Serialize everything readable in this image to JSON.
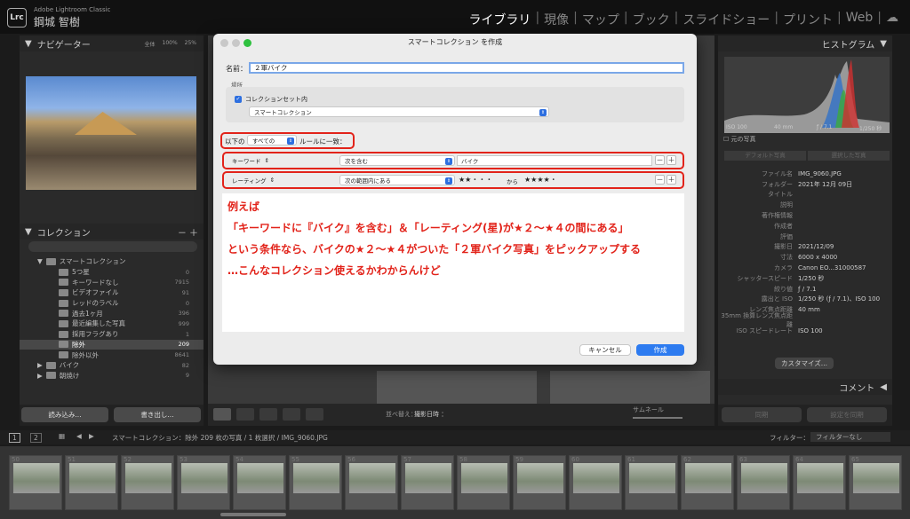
{
  "app": {
    "logo": "Lrc",
    "name": "Adobe Lightroom Classic",
    "user": "鋼城 智樹"
  },
  "modules": [
    "ライブラリ",
    "現像",
    "マップ",
    "ブック",
    "スライドショー",
    "プリント",
    "Web"
  ],
  "left": {
    "navigator": {
      "title": "ナビゲーター",
      "zoom": [
        "全体",
        "100%",
        "25%"
      ]
    },
    "collections": {
      "title": "コレクション",
      "smart_set": "スマートコレクション",
      "items": [
        {
          "label": "5つ星",
          "count": "0"
        },
        {
          "label": "キーワードなし",
          "count": "7915"
        },
        {
          "label": "ビデオファイル",
          "count": "91"
        },
        {
          "label": "レッドのラベル",
          "count": "0"
        },
        {
          "label": "過去1ヶ月",
          "count": "396"
        },
        {
          "label": "最近編集した写真",
          "count": "999"
        },
        {
          "label": "採用フラグあり",
          "count": "1"
        },
        {
          "label": "除外",
          "count": "209"
        },
        {
          "label": "除外以外",
          "count": "8641"
        }
      ],
      "folders": [
        {
          "label": "バイク",
          "count": "82"
        },
        {
          "label": "朝焼け",
          "count": "9"
        }
      ]
    },
    "import_btn": "読み込み...",
    "export_btn": "書き出し..."
  },
  "toolbar": {
    "sort_label": "並べ替え：",
    "sort_value": "撮影日時 ：",
    "thumb_label": "サムネール"
  },
  "right": {
    "histogram": {
      "title": "ヒストグラム",
      "iso": "ISO 100",
      "focal": "40 mm",
      "aperture": "ƒ / 7.1",
      "shutter": "1/250 秒",
      "original": "元の写真"
    },
    "tabs": [
      "デフォルト写真",
      "選択した写真"
    ],
    "metadata": [
      {
        "k": "ファイル名",
        "v": "IMG_9060.JPG"
      },
      {
        "k": "フォルダー",
        "v": "2021年 12月 09日"
      },
      {
        "k": "タイトル",
        "v": ""
      },
      {
        "k": "説明",
        "v": ""
      },
      {
        "k": "著作権情報",
        "v": ""
      },
      {
        "k": "作成者",
        "v": ""
      },
      {
        "k": "評価",
        "v": ""
      },
      {
        "k": "撮影日",
        "v": "2021/12/09"
      },
      {
        "k": "寸法",
        "v": "6000 x 4000"
      },
      {
        "k": "カメラ",
        "v": "Canon EO...31000587"
      },
      {
        "k": "シャッタースピード",
        "v": "1/250 秒"
      },
      {
        "k": "絞り値",
        "v": "ƒ / 7.1"
      },
      {
        "k": "露出と ISO",
        "v": "1/250 秒 (ƒ / 7.1)、ISO 100"
      },
      {
        "k": "レンズ焦点距離",
        "v": "40 mm"
      },
      {
        "k": "35mm 換算レンズ焦点距離",
        "v": ""
      },
      {
        "k": "ISO スピードレート",
        "v": "ISO 100"
      }
    ],
    "customize": "カスタマイズ...",
    "comments": "コメント",
    "sync": "同期",
    "sync_settings": "設定を同期"
  },
  "filmbar": {
    "pages": [
      "1",
      "2"
    ],
    "path": "スマートコレクション：除外 209 枚の写真 / 1 枚選択 / IMG_9060.JPG",
    "filter_label": "フィルター：",
    "filter_value": "フィルターなし"
  },
  "film_numbers": [
    "50",
    "51",
    "52",
    "53",
    "54",
    "55",
    "56",
    "57",
    "58",
    "59",
    "60",
    "61",
    "62",
    "63",
    "64",
    "65"
  ],
  "dialog": {
    "title": "スマートコレクション を作成",
    "name_label": "名前：",
    "name_value": "２軍バイク",
    "location_label": "場所",
    "in_set_label": "コレクションセット内",
    "set_value": "スマートコレクション",
    "match_prefix": "以下の",
    "match_value": "すべての",
    "match_suffix": "ルールに一致：",
    "rule1": {
      "field": "キーワード",
      "op": "次を含む",
      "value": "バイク"
    },
    "rule2": {
      "field": "レーティング",
      "op": "次の範囲内にある",
      "from": "★★・・・",
      "between": "から",
      "to": "★★★★・"
    },
    "cancel": "キャンセル",
    "create": "作成"
  },
  "annotation": {
    "heading": "例えば",
    "lines": [
      "「キーワードに『バイク』を含む」＆「レーティング(星)が★２〜★４の間にある」",
      "という条件なら、バイクの★２〜★４がついた「２軍バイク写真」をピックアップする",
      "…こんなコレクション使えるかわからんけど"
    ]
  }
}
